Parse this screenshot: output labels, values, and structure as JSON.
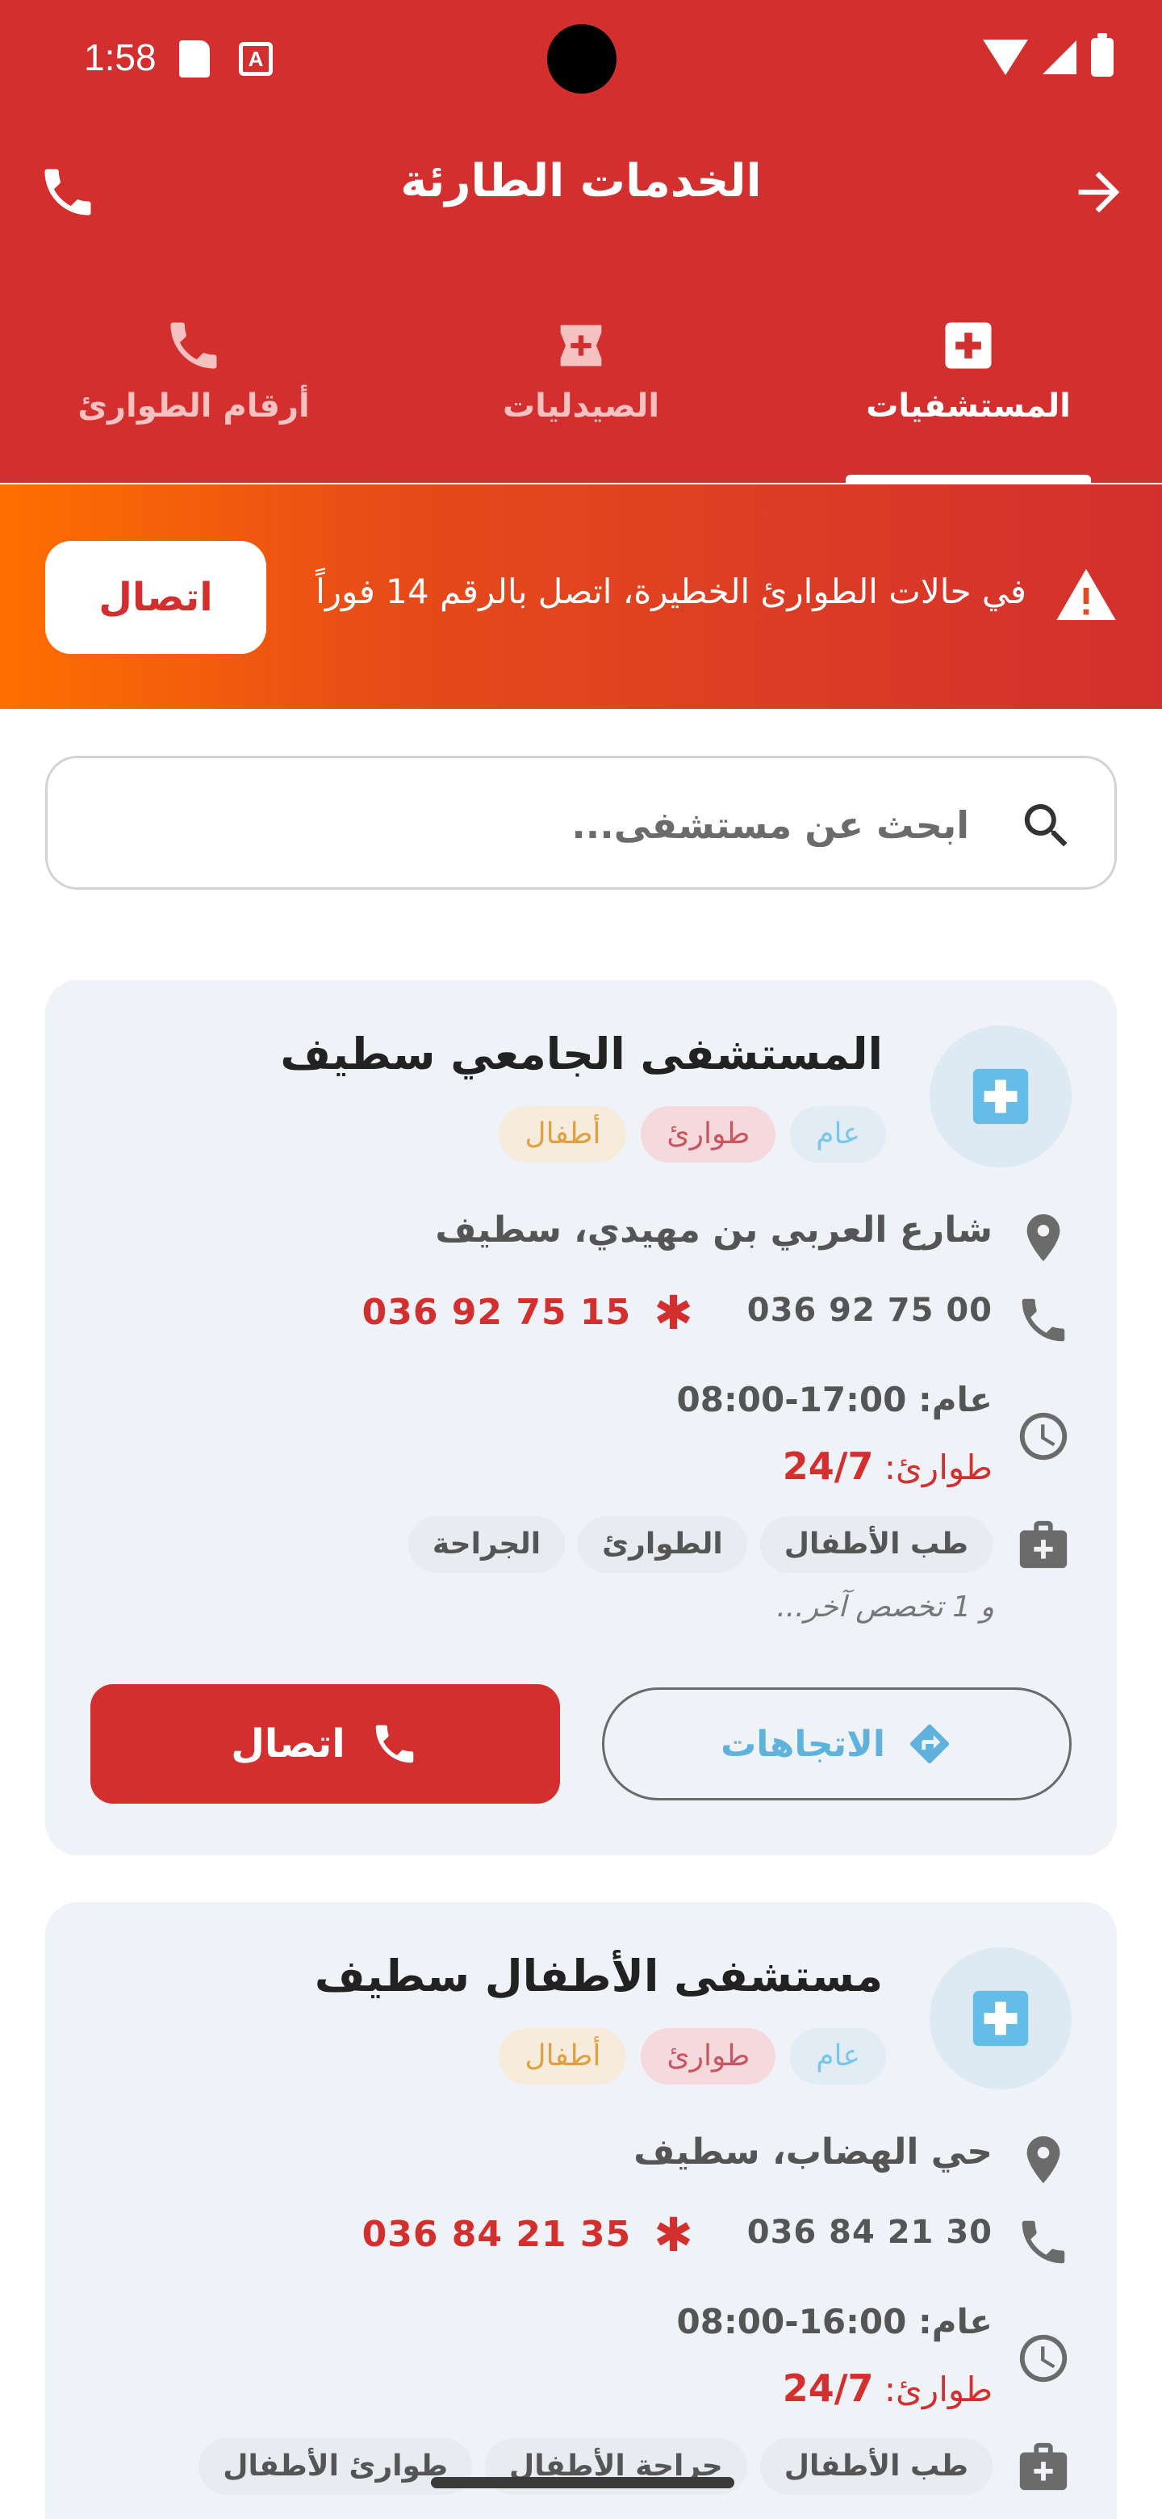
{
  "status_bar": {
    "time": "1:58"
  },
  "app_bar": {
    "title": "الخدمات الطارئة"
  },
  "tabs": [
    {
      "label": "المستشفيات",
      "active": true,
      "icon": "hospital-icon"
    },
    {
      "label": "الصيدليات",
      "active": false,
      "icon": "pharmacy-icon"
    },
    {
      "label": "أرقام الطوارئ",
      "active": false,
      "icon": "phone-icon"
    }
  ],
  "banner": {
    "text": "في حالات الطوارئ الخطيرة، اتصل بالرقم 14 فوراً",
    "button_label": "اتصال",
    "icon": "warning-icon"
  },
  "search": {
    "placeholder": "ابحث عن مستشفى..."
  },
  "hospitals": [
    {
      "name": "المستشفى الجامعي سطيف",
      "chips": [
        "عام",
        "طوارئ",
        "أطفال"
      ],
      "address": "شارع العربي بن مهيدي، سطيف",
      "phone": "036 92 75 00",
      "emergency_phone": "036 92 75 15",
      "hours_general_label": "عام:",
      "hours_general": "08:00-17:00",
      "hours_emergency_label": "طوارئ:",
      "hours_emergency": "24/7",
      "specialties": [
        "طب الأطفال",
        "الطوارئ",
        "الجراحة"
      ],
      "more": "و 1 تخصص آخر...",
      "directions_label": "الاتجاهات",
      "call_label": "اتصال"
    },
    {
      "name": "مستشفى الأطفال سطيف",
      "chips": [
        "عام",
        "طوارئ",
        "أطفال"
      ],
      "address": "حي الهضاب، سطيف",
      "phone": "036 84 21 30",
      "emergency_phone": "036 84 21 35",
      "hours_general_label": "عام:",
      "hours_general": "08:00-16:00",
      "hours_emergency_label": "طوارئ:",
      "hours_emergency": "24/7",
      "specialties": [
        "طب الأطفال",
        "جراحة الأطفال",
        "طوارئ الأطفال"
      ]
    }
  ],
  "colors": {
    "primary": "#d32f2f",
    "banner_start": "#ff6f00",
    "card_bg": "#eff2f6",
    "directions": "#5fb2dc"
  }
}
